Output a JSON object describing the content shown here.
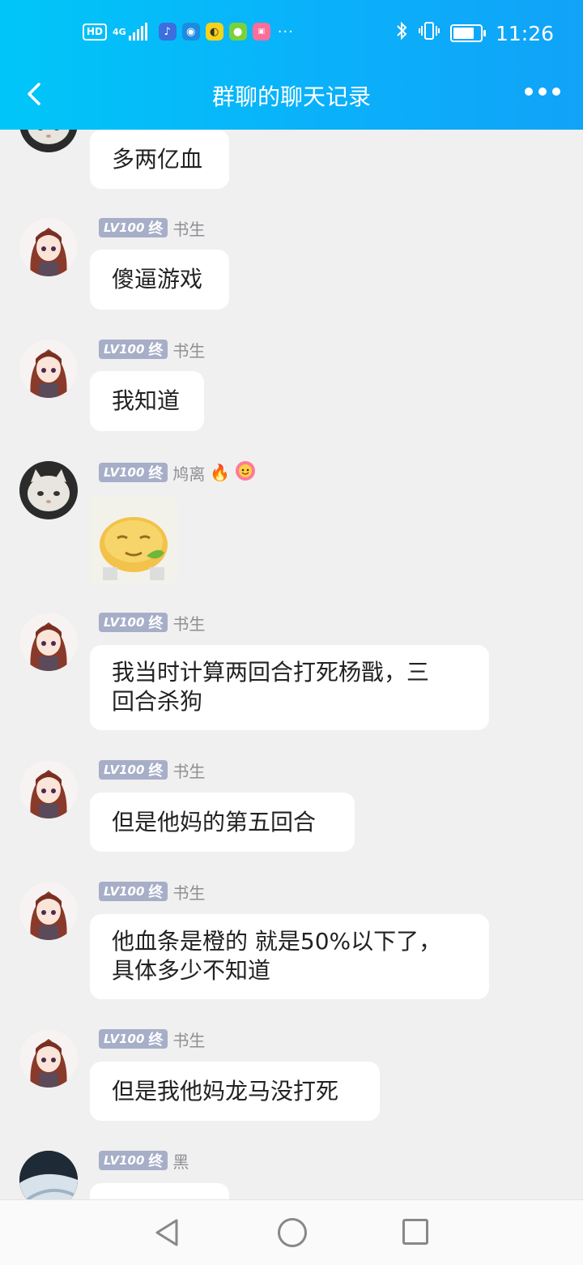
{
  "status_bar": {
    "hd": "HD",
    "network": "4G",
    "time": "11:26",
    "battery_level": 0.85,
    "notification_icons": [
      "music-icon",
      "browser-icon",
      "qq-icon",
      "gold-medal-icon",
      "bilibili-icon"
    ],
    "overflow": "···"
  },
  "header": {
    "title": "群聊的聊天记录",
    "back_icon": "chevron-left-icon",
    "more_icon": "more-dots-icon"
  },
  "badge": {
    "level": "LV100",
    "tag": "终"
  },
  "messages": [
    {
      "text": "多两亿血"
    },
    {
      "nick": "书生",
      "text": "傻逼游戏"
    },
    {
      "nick": "书生",
      "text": "我知道"
    },
    {
      "nick": "鸠离",
      "emoji1": "🔥",
      "sticker": "smiling-orange-sticker"
    },
    {
      "nick": "书生",
      "text_line1": "我当时计算两回合打死杨戬，三",
      "text_line2": "回合杀狗"
    },
    {
      "nick": "书生",
      "text": "但是他妈的第五回合"
    },
    {
      "nick": "书生",
      "text_line1": "他血条是橙的 就是50%以下了，",
      "text_line2": "具体多少不知道"
    },
    {
      "nick": "书生",
      "text": "但是我他妈龙马没打死"
    },
    {
      "nick": "黑"
    }
  ],
  "bottom_nav": {
    "back": "nav-back-icon",
    "home": "nav-home-icon",
    "recent": "nav-recent-icon"
  }
}
